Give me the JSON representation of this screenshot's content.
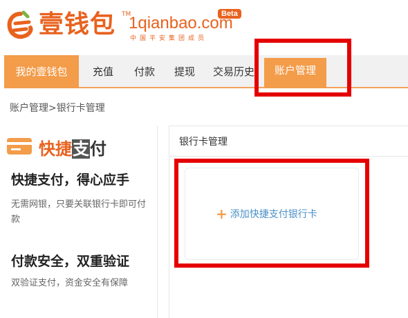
{
  "logo": {
    "brand_cn": "壹钱包",
    "tm": "TM",
    "domain": "1qianbao.com",
    "beta": "Beta",
    "sub": "中国平安集团成员"
  },
  "nav": {
    "items": [
      "我的壹钱包",
      "充值",
      "付款",
      "提现",
      "交易历史",
      "账户管理"
    ]
  },
  "breadcrumb": "账户管理>银行卡管理",
  "left": {
    "quick_pay": {
      "part1": "快捷",
      "part2": "支",
      "part3": "付"
    },
    "features": [
      {
        "title": "快捷支付，得心应手",
        "desc": "无需网银，只要关联银行卡即可付款"
      },
      {
        "title": "付款安全，双重验证",
        "desc": "双验证支付，资金安全有保障"
      }
    ]
  },
  "right": {
    "title": "银行卡管理",
    "add_plus": "+",
    "add_label": "添加快捷支付银行卡"
  },
  "colors": {
    "brand": "#e8621e",
    "nav_active": "#f39c4a",
    "highlight": "#e50000",
    "link": "#4a90c8"
  }
}
